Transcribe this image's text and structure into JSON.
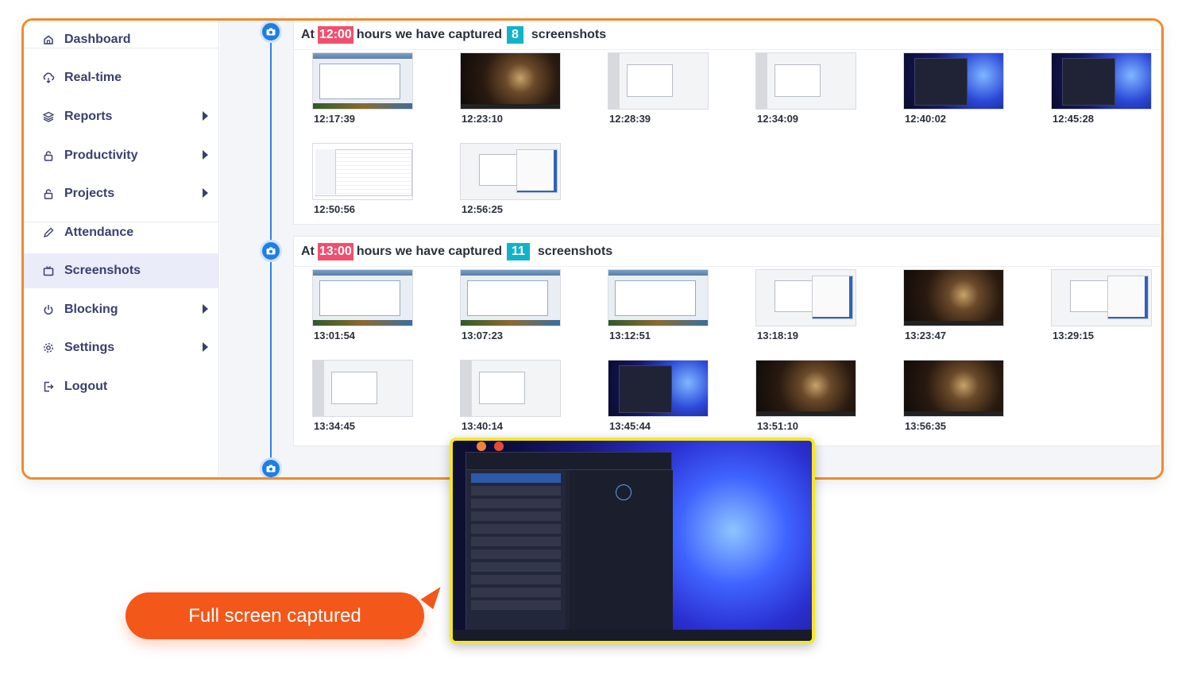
{
  "sidebar": {
    "items": [
      {
        "label": "Dashboard",
        "icon": "home-icon",
        "has_arrow": false
      },
      {
        "label": "Real-time",
        "icon": "cloud-icon",
        "has_arrow": false
      },
      {
        "label": "Reports",
        "icon": "layers-icon",
        "has_arrow": true
      },
      {
        "label": "Productivity",
        "icon": "lock-icon",
        "has_arrow": true
      },
      {
        "label": "Projects",
        "icon": "lock-icon",
        "has_arrow": true
      },
      {
        "label": "Attendance",
        "icon": "pencil-icon",
        "has_arrow": false
      },
      {
        "label": "Screenshots",
        "icon": "tv-icon",
        "has_arrow": false,
        "active": true
      },
      {
        "label": "Blocking",
        "icon": "power-icon",
        "has_arrow": true
      },
      {
        "label": "Settings",
        "icon": "gear-icon",
        "has_arrow": true
      },
      {
        "label": "Logout",
        "icon": "logout-icon",
        "has_arrow": false
      }
    ]
  },
  "sections": [
    {
      "prefix": "At",
      "hour": "12:00",
      "middle": "hours we have captured",
      "count": "8",
      "suffix": "screenshots",
      "shots": [
        {
          "time": "12:17:39",
          "kind": "window"
        },
        {
          "time": "12:23:10",
          "kind": "coffee"
        },
        {
          "time": "12:28:39",
          "kind": "dialog"
        },
        {
          "time": "12:34:09",
          "kind": "dialog"
        },
        {
          "time": "12:40:02",
          "kind": "fractal"
        },
        {
          "time": "12:45:28",
          "kind": "fractal"
        },
        {
          "time": "12:50:56",
          "kind": "explorer"
        },
        {
          "time": "12:56:25",
          "kind": "calc"
        }
      ]
    },
    {
      "prefix": "At",
      "hour": "13:00",
      "middle": "hours we have captured",
      "count": "11",
      "suffix": "screenshots",
      "shots": [
        {
          "time": "13:01:54",
          "kind": "window"
        },
        {
          "time": "13:07:23",
          "kind": "window"
        },
        {
          "time": "13:12:51",
          "kind": "window"
        },
        {
          "time": "13:18:19",
          "kind": "calc"
        },
        {
          "time": "13:23:47",
          "kind": "coffee"
        },
        {
          "time": "13:29:15",
          "kind": "calc"
        },
        {
          "time": "13:34:45",
          "kind": "dialog"
        },
        {
          "time": "13:40:14",
          "kind": "dialog"
        },
        {
          "time": "13:45:44",
          "kind": "fractal"
        },
        {
          "time": "13:51:10",
          "kind": "coffee"
        },
        {
          "time": "13:56:35",
          "kind": "coffee"
        }
      ]
    }
  ],
  "callout": {
    "label": "Full screen captured"
  },
  "colors": {
    "accent": "#f4571a",
    "frame": "#f08a2c",
    "hour_badge": "#f0506e",
    "count_badge": "#12b3c9",
    "timeline": "#1e7ee6"
  }
}
